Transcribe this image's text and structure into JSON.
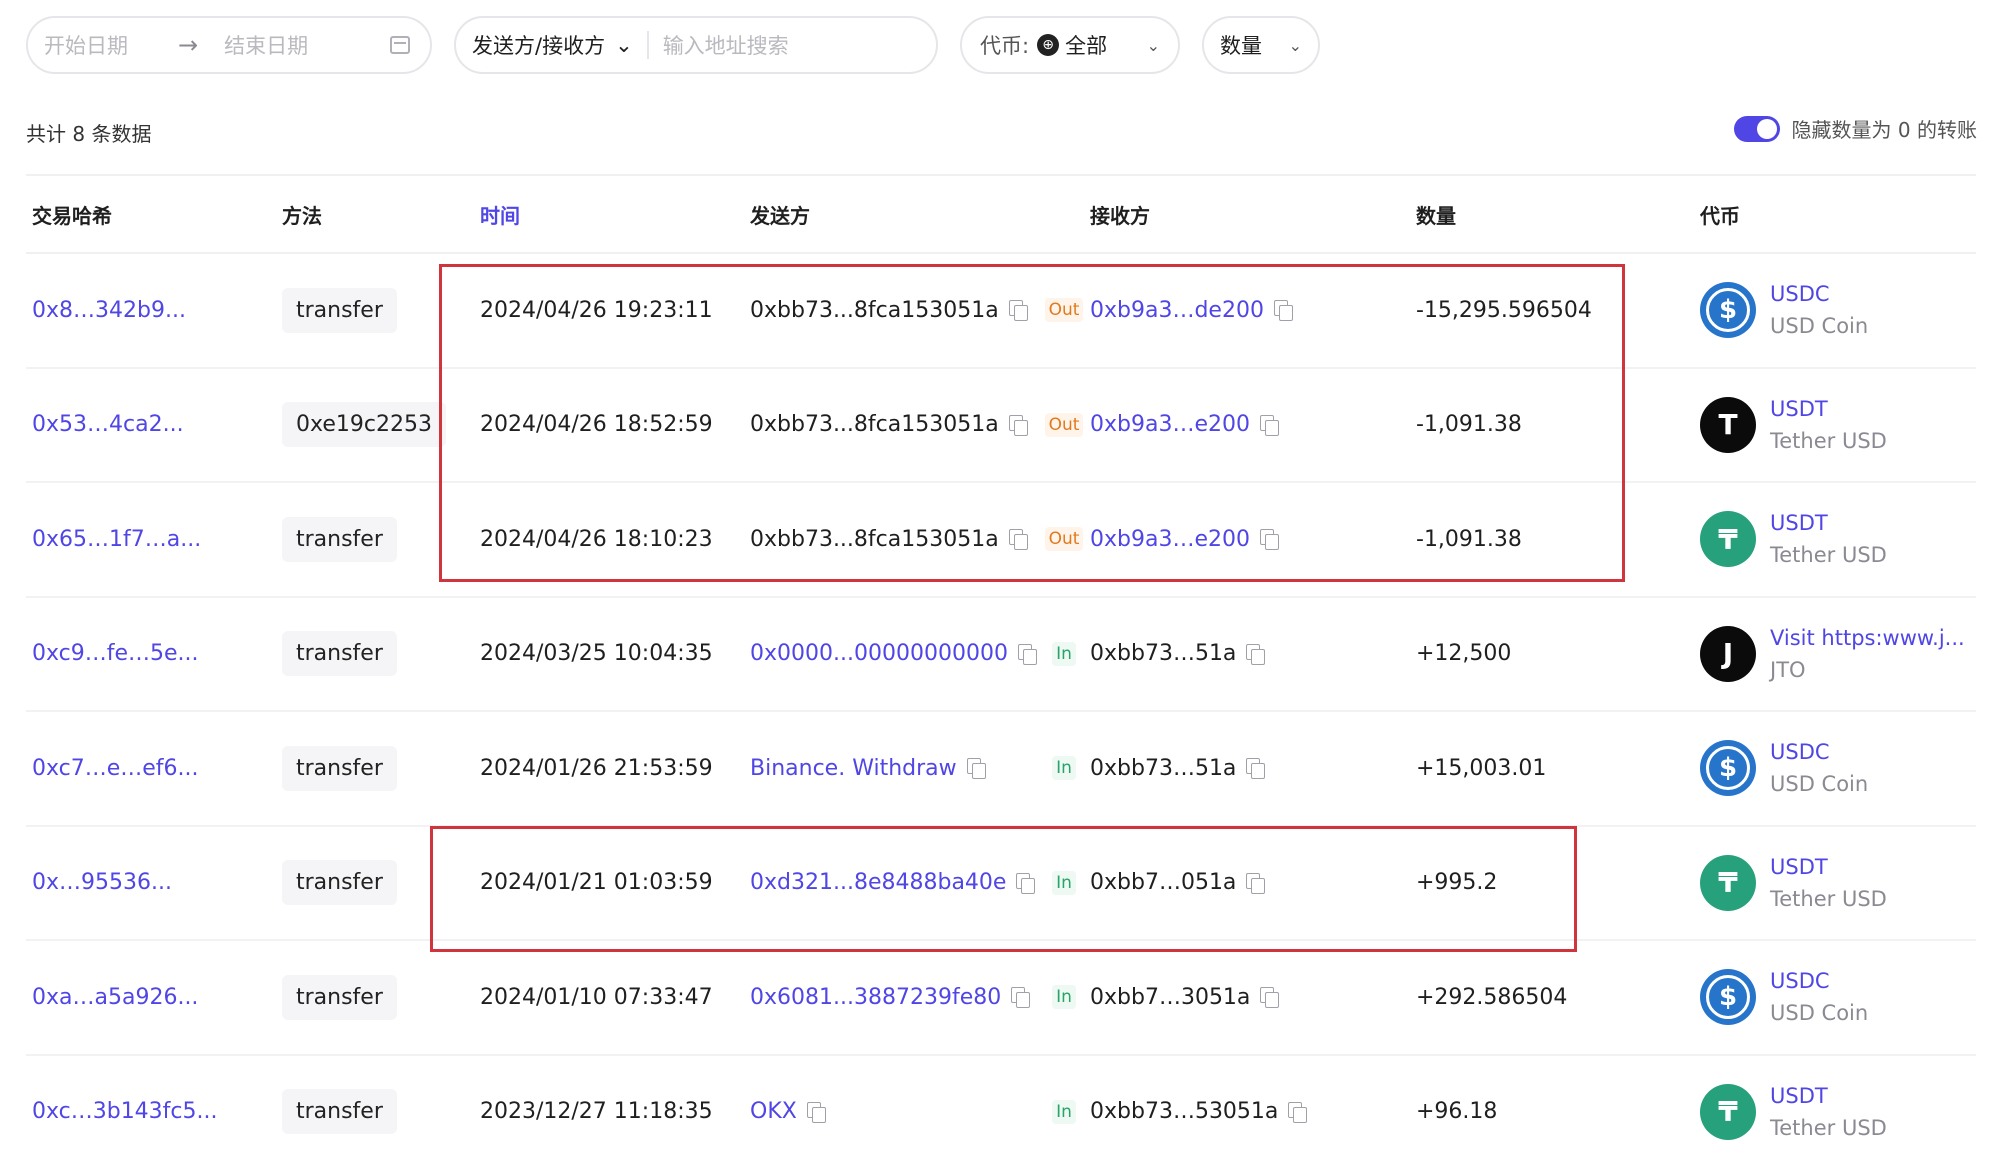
{
  "filters": {
    "start_date_placeholder": "开始日期",
    "end_date_placeholder": "结束日期",
    "party_select": "发送方/接收方",
    "address_placeholder": "输入地址搜索",
    "token_label": "代币:",
    "token_value": "全部",
    "amount_label": "数量"
  },
  "summary": {
    "count_text": "共计 8 条数据",
    "toggle_label": "隐藏数量为 0 的转账",
    "toggle_on": true
  },
  "table": {
    "headers": {
      "hash": "交易哈希",
      "method": "方法",
      "time": "时间",
      "from": "发送方",
      "to": "接收方",
      "amount": "数量",
      "token": "代币"
    },
    "rows": [
      {
        "hash": "0x8…342b9...",
        "method": "transfer",
        "time": "2024/04/26 19:23:11",
        "from": "0xbb73...8fca153051a",
        "direction": "Out",
        "to": "0xb9a3…de200",
        "amount": "-15,295.596504",
        "token_symbol": "USDC",
        "token_name": "USD Coin",
        "token_icon": "usdc-icon"
      },
      {
        "hash": "0x53…4ca2...",
        "method": "0xe19c2253",
        "time": "2024/04/26 18:52:59",
        "from": "0xbb73...8fca153051a",
        "direction": "Out",
        "to": "0xb9a3…e200",
        "amount": "-1,091.38",
        "token_symbol": "USDT",
        "token_name": "Tether USD",
        "token_icon": "tether-black-icon"
      },
      {
        "hash": "0x65…1f7…a...",
        "method": "transfer",
        "time": "2024/04/26 18:10:23",
        "from": "0xbb73...8fca153051a",
        "direction": "Out",
        "to": "0xb9a3…e200",
        "amount": "-1,091.38",
        "token_symbol": "USDT",
        "token_name": "Tether USD",
        "token_icon": "tether-green-icon"
      },
      {
        "hash": "0xc9…fe…5e...",
        "method": "transfer",
        "time": "2024/03/25 10:04:35",
        "from": "0x0000...00000000000",
        "direction": "In",
        "to": "0xbb73…51a",
        "amount": "+12,500",
        "token_symbol": "Visit https:www.j...",
        "token_name": "JTO",
        "token_icon": "jto-icon"
      },
      {
        "hash": "0xc7…e…ef6...",
        "method": "transfer",
        "time": "2024/01/26 21:53:59",
        "from": "Binance. Withdraw",
        "direction": "In",
        "to": "0xbb73…51a",
        "amount": "+15,003.01",
        "token_symbol": "USDC",
        "token_name": "USD Coin",
        "token_icon": "usdc-icon"
      },
      {
        "hash": "0x…95536...",
        "method": "transfer",
        "time": "2024/01/21 01:03:59",
        "from": "0xd321...8e8488ba40e",
        "direction": "In",
        "to": "0xbb7…051a",
        "amount": "+995.2",
        "token_symbol": "USDT",
        "token_name": "Tether USD",
        "token_icon": "tether-green-icon"
      },
      {
        "hash": "0xa…a5a926...",
        "method": "transfer",
        "time": "2024/01/10 07:33:47",
        "from": "0x6081...3887239fe80",
        "direction": "In",
        "to": "0xbb7…3051a",
        "amount": "+292.586504",
        "token_symbol": "USDC",
        "token_name": "USD Coin",
        "token_icon": "usdc-icon"
      },
      {
        "hash": "0xc…3b143fc5...",
        "method": "transfer",
        "time": "2023/12/27 11:18:35",
        "from": "OKX",
        "direction": "In",
        "to": "0xbb73…53051a",
        "amount": "+96.18",
        "token_symbol": "USDT",
        "token_name": "Tether USD",
        "token_icon": "tether-green-icon"
      }
    ]
  },
  "colors": {
    "accent": "#4f46e5",
    "highlight_box": "#d0343c",
    "out_badge": "#e07a1f",
    "in_badge": "#2aa36b"
  }
}
